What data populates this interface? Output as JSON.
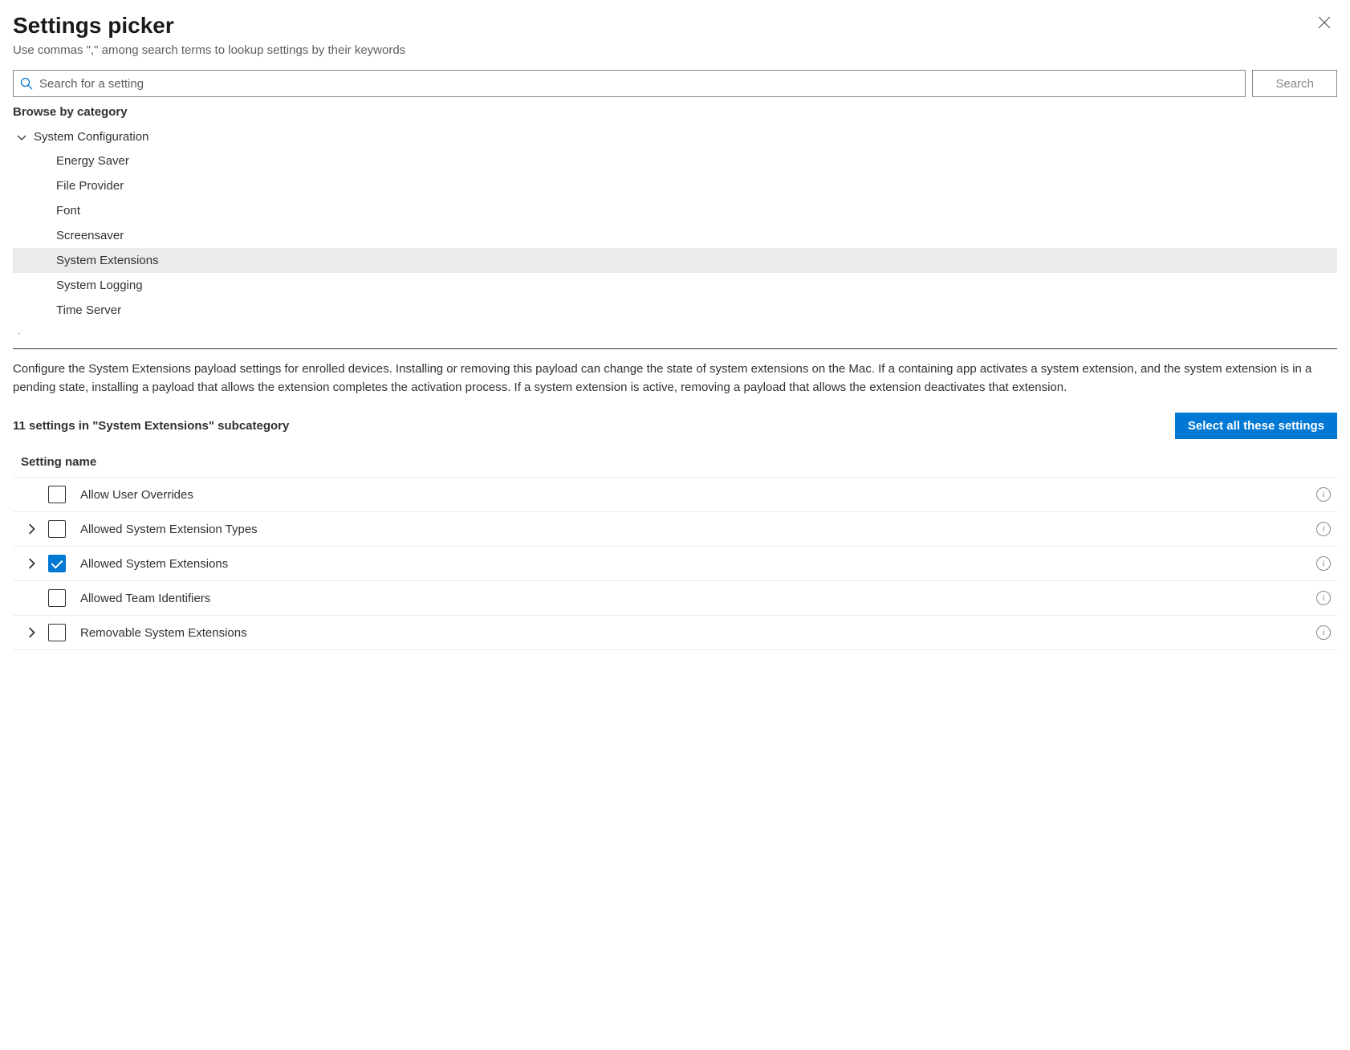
{
  "header": {
    "title": "Settings picker",
    "subtitle": "Use commas \",\" among search terms to lookup settings by their keywords"
  },
  "search": {
    "placeholder": "Search for a setting",
    "button_label": "Search"
  },
  "browse": {
    "label": "Browse by category",
    "category": {
      "name": "System Configuration",
      "expanded": true,
      "items": [
        {
          "label": "Energy Saver",
          "selected": false
        },
        {
          "label": "File Provider",
          "selected": false
        },
        {
          "label": "Font",
          "selected": false
        },
        {
          "label": "Screensaver",
          "selected": false
        },
        {
          "label": "System Extensions",
          "selected": true
        },
        {
          "label": "System Logging",
          "selected": false
        },
        {
          "label": "Time Server",
          "selected": false
        }
      ]
    }
  },
  "description": "Configure the System Extensions payload settings for enrolled devices. Installing or removing this payload can change the state of system extensions on the Mac. If a containing app activates a system extension, and the system extension is in a pending state, installing a payload that allows the extension completes the activation process. If a system extension is active, removing a payload that allows the extension deactivates that extension.",
  "settings_section": {
    "count_label": "11 settings in \"System Extensions\" subcategory",
    "select_all_label": "Select all these settings",
    "column_header": "Setting name",
    "rows": [
      {
        "label": "Allow User Overrides",
        "expandable": false,
        "checked": false
      },
      {
        "label": "Allowed System Extension Types",
        "expandable": true,
        "checked": false
      },
      {
        "label": "Allowed System Extensions",
        "expandable": true,
        "checked": true
      },
      {
        "label": "Allowed Team Identifiers",
        "expandable": false,
        "checked": false
      },
      {
        "label": "Removable System Extensions",
        "expandable": true,
        "checked": false
      }
    ]
  }
}
